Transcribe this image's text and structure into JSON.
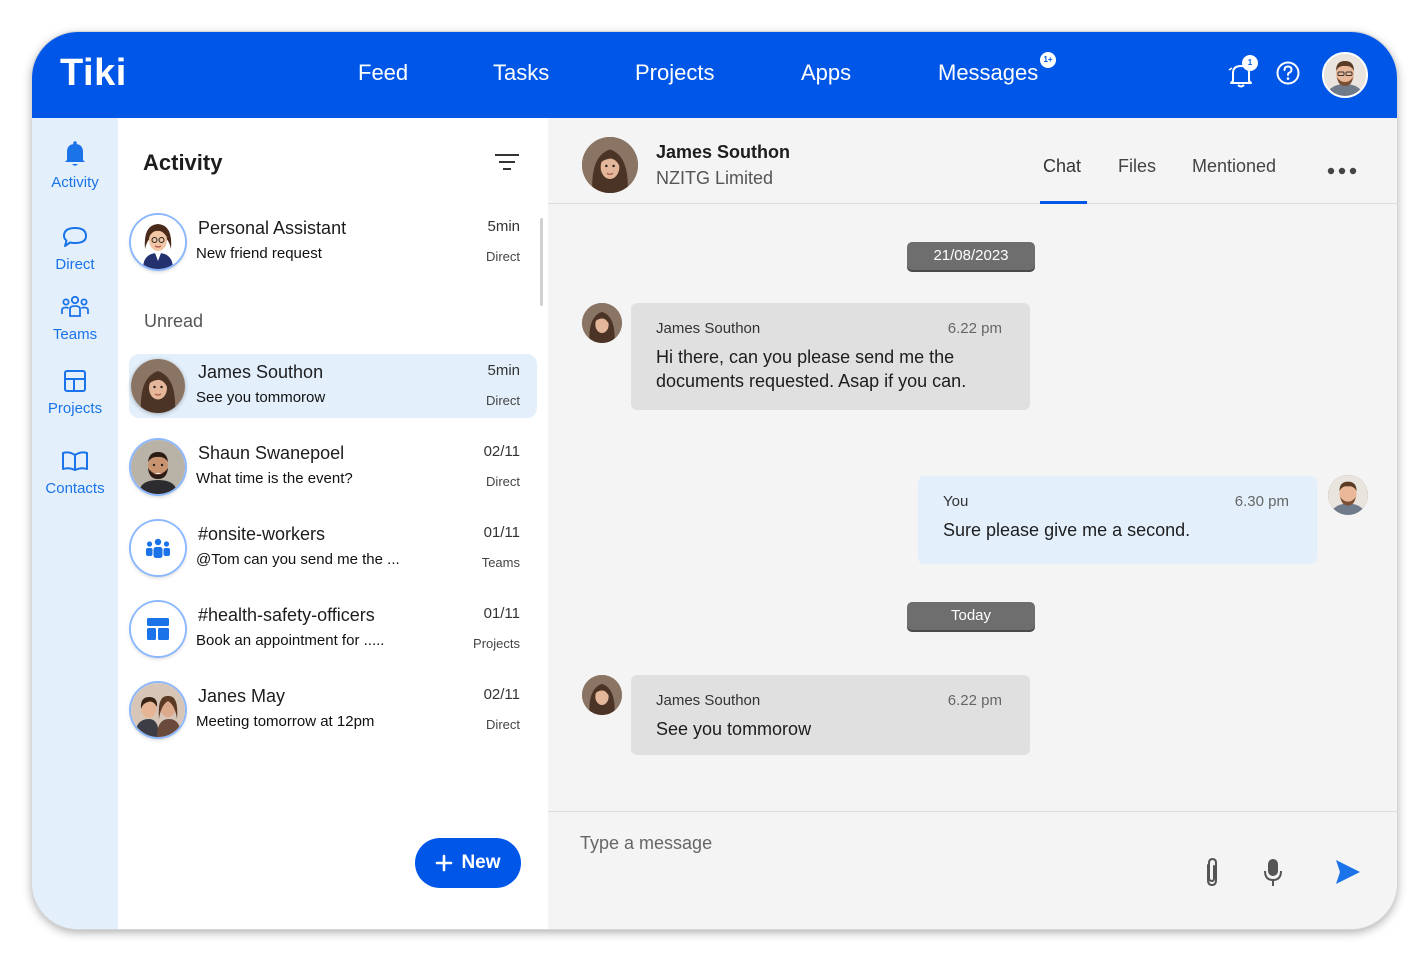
{
  "app": {
    "logo": "Tiki"
  },
  "nav": {
    "items": [
      {
        "label": "Feed"
      },
      {
        "label": "Tasks"
      },
      {
        "label": "Projects"
      },
      {
        "label": "Apps"
      },
      {
        "label": "Messages"
      }
    ],
    "messages_badge": "1+",
    "notifications_badge": "1"
  },
  "rail": {
    "items": [
      {
        "label": "Activity",
        "icon": "bell-icon"
      },
      {
        "label": "Direct",
        "icon": "chat-bubble-icon"
      },
      {
        "label": "Teams",
        "icon": "people-icon"
      },
      {
        "label": "Projects",
        "icon": "layout-icon"
      },
      {
        "label": "Contacts",
        "icon": "book-icon"
      }
    ]
  },
  "activity": {
    "title": "Activity",
    "unread_label": "Unread",
    "new_button": "New",
    "conversations": [
      {
        "name": "Personal Assistant",
        "preview": "New friend request",
        "time": "5min",
        "kind": "Direct"
      },
      {
        "name": "James Southon",
        "preview": "See you tommorow",
        "time": "5min",
        "kind": "Direct"
      },
      {
        "name": "Shaun Swanepoel",
        "preview": "What time is the event?",
        "time": "02/11",
        "kind": "Direct"
      },
      {
        "name": "#onsite-workers",
        "preview": "@Tom can you send me the ...",
        "time": "01/11",
        "kind": "Teams"
      },
      {
        "name": "#health-safety-officers",
        "preview": "Book an appointment for .....",
        "time": "01/11",
        "kind": "Projects"
      },
      {
        "name": "Janes May",
        "preview": "Meeting tomorrow at 12pm",
        "time": "02/11",
        "kind": "Direct"
      }
    ]
  },
  "chat": {
    "contact_name": "James Southon",
    "contact_company": "NZITG Limited",
    "tabs": [
      {
        "label": "Chat"
      },
      {
        "label": "Files"
      },
      {
        "label": "Mentioned"
      }
    ],
    "dates": [
      "21/08/2023",
      "Today"
    ],
    "messages": [
      {
        "sender": "James Southon",
        "time": "6.22 pm",
        "text": "Hi there, can you please send me the documents requested. Asap if you can."
      },
      {
        "sender": "You",
        "time": "6.30 pm",
        "text": "Sure please give me a second."
      },
      {
        "sender": "James Southon",
        "time": "6.22 pm",
        "text": "See you tommorow"
      }
    ],
    "composer_placeholder": "Type a message"
  },
  "colors": {
    "brand": "#0057e7",
    "rail_bg": "#e3f0fc",
    "incoming_bubble": "#e0e0e0",
    "outgoing_bubble": "#e3f0fc"
  }
}
